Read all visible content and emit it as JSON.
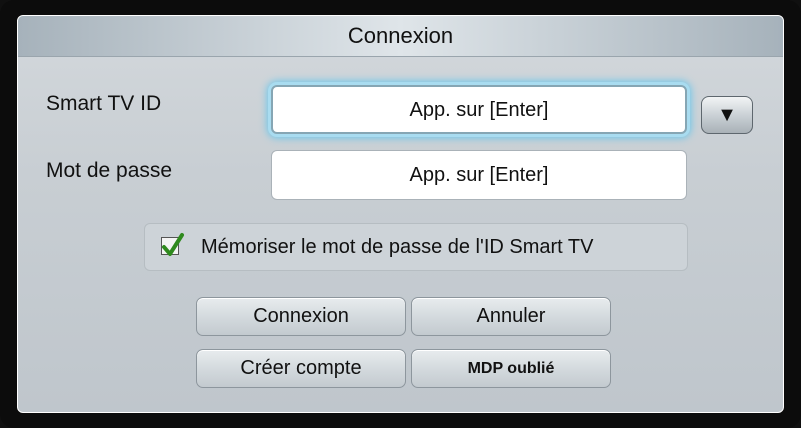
{
  "dialog": {
    "title": "Connexion",
    "id_label": "Smart TV ID",
    "id_value": "App. sur [Enter]",
    "password_label": "Mot de passe",
    "password_value": "App. sur [Enter]",
    "dropdown_glyph": "▼",
    "remember_label": "Mémoriser le mot de passe de l'ID Smart TV",
    "remember_checked": true,
    "buttons": {
      "login": "Connexion",
      "cancel": "Annuler",
      "create_account": "Créer compte",
      "forgot_password": "MDP oublié"
    }
  },
  "colors": {
    "focus_glow": "#6cc6ea",
    "check_green": "#2f8a1e"
  },
  "icons": {
    "dropdown": "triangle-down-icon",
    "checkbox": "checkmark-icon"
  }
}
